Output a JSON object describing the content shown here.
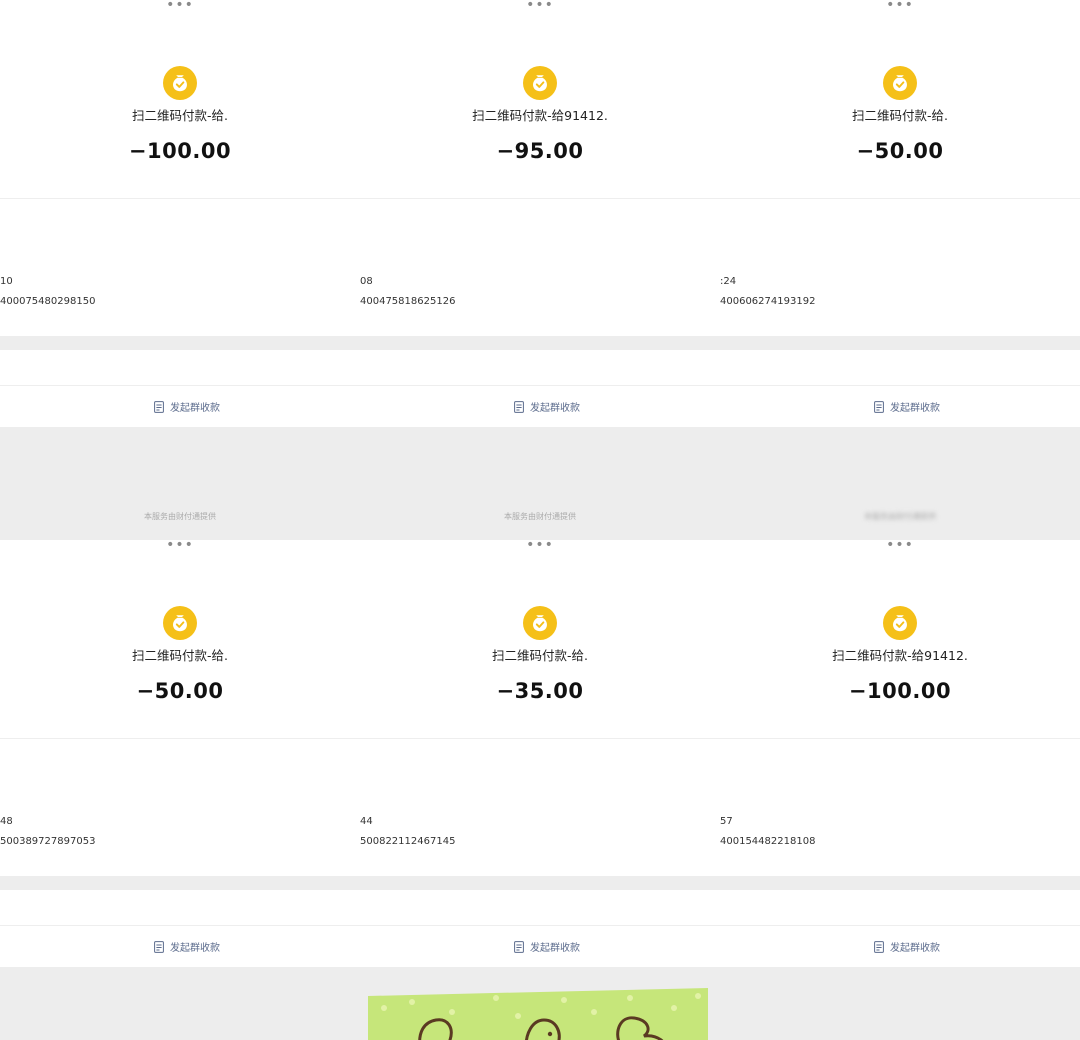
{
  "colors": {
    "icon_yellow": "#f5c018",
    "group_link": "#5b6b8c",
    "page_bg": "#ededed",
    "sticker_green": "#c6e67a"
  },
  "icons": {
    "more": "more-dots-icon",
    "payment": "money-bag-check-icon",
    "group": "document-icon"
  },
  "panels": [
    {
      "more": "•••",
      "title": "扫二维码付款-给.",
      "amount": "−100.00",
      "time_fragment": "10",
      "order_no": "400075480298150",
      "group_label": "发起群收款",
      "footer": "本服务由财付通提供",
      "footer_blurred": false
    },
    {
      "more": "•••",
      "title": "扫二维码付款-给91412.",
      "amount": "−95.00",
      "time_fragment": "08",
      "order_no": "400475818625126",
      "group_label": "发起群收款",
      "footer": "本服务由财付通提供",
      "footer_blurred": false
    },
    {
      "more": "•••",
      "title": "扫二维码付款-给.",
      "amount": "−50.00",
      "time_fragment": ":24",
      "order_no": "400606274193192",
      "group_label": "发起群收款",
      "footer": "本服务由财付通提供",
      "footer_blurred": true
    },
    {
      "more": "•••",
      "title": "扫二维码付款-给.",
      "amount": "−50.00",
      "time_fragment": "48",
      "order_no": "500389727897053",
      "group_label": "发起群收款"
    },
    {
      "more": "•••",
      "title": "扫二维码付款-给.",
      "amount": "−35.00",
      "time_fragment": "44",
      "order_no": "500822112467145",
      "group_label": "发起群收款"
    },
    {
      "more": "•••",
      "title": "扫二维码付款-给91412.",
      "amount": "−100.00",
      "time_fragment": "57",
      "order_no": "400154482218108",
      "group_label": "发起群收款"
    }
  ]
}
